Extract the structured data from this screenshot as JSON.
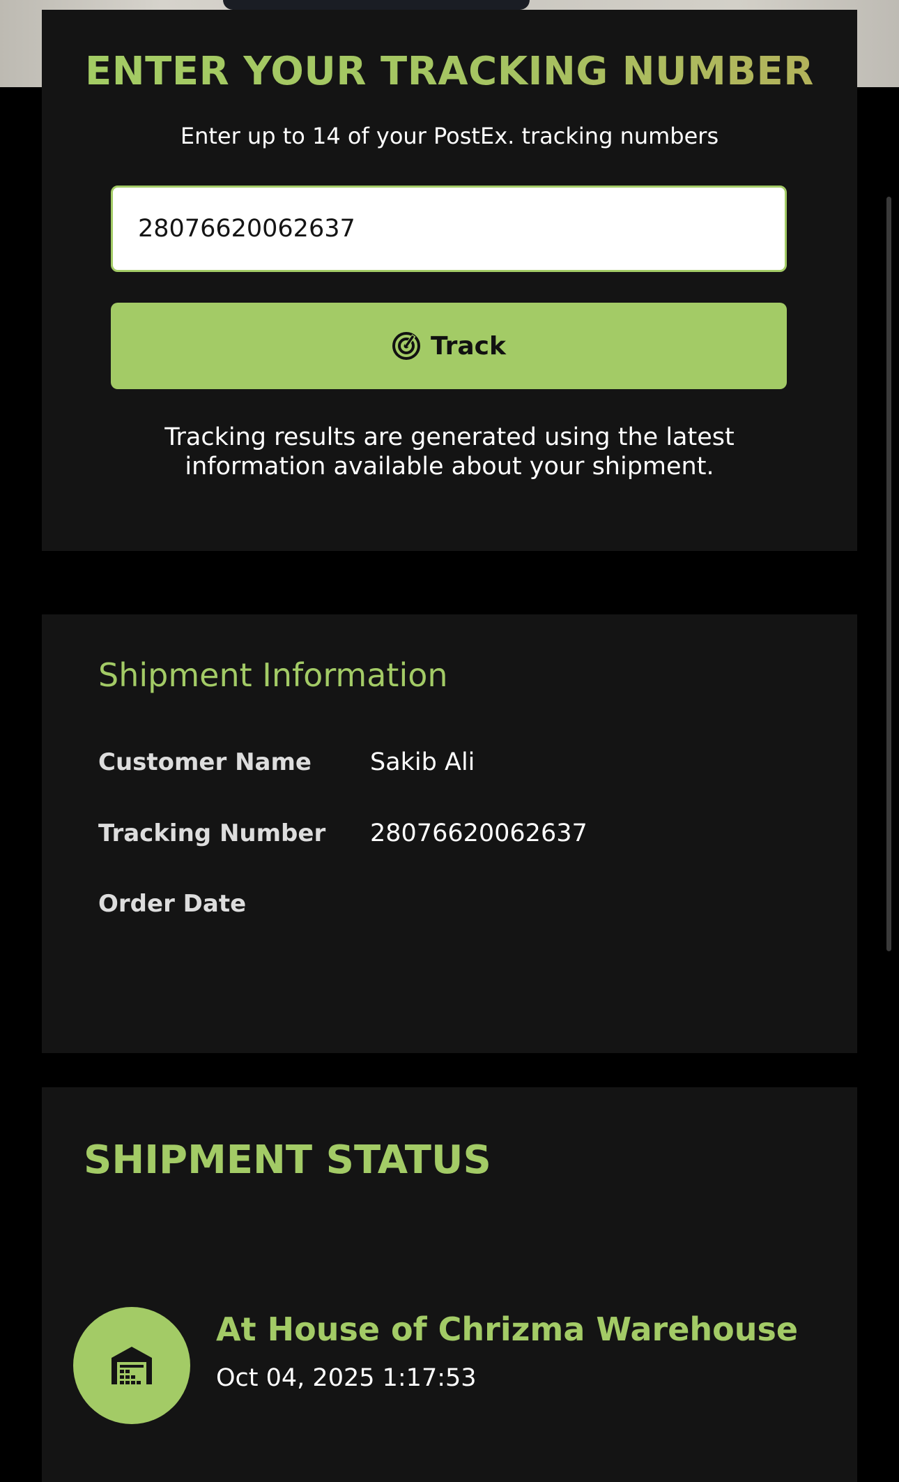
{
  "theme": {
    "accent": "#a3cb66",
    "panel_background": "#141414",
    "page_background": "#000000",
    "text": "#ffffff"
  },
  "tracking_form": {
    "title": "ENTER YOUR TRACKING NUMBER",
    "subtitle": "Enter up to 14 of your PostEx. tracking numbers",
    "input_value": "28076620062637",
    "button_label": "Track",
    "button_icon": "radar-icon",
    "note": "Tracking results are generated using the latest information available about your shipment."
  },
  "shipment_info": {
    "title": "Shipment Information",
    "rows": [
      {
        "label": "Customer Name",
        "value": "Sakib Ali"
      },
      {
        "label": "Tracking Number",
        "value": "28076620062637"
      },
      {
        "label": "Order Date",
        "value": ""
      }
    ]
  },
  "shipment_status": {
    "title": "SHIPMENT STATUS",
    "events": [
      {
        "icon": "warehouse-icon",
        "label": "At House of Chrizma Warehouse",
        "timestamp": "Oct 04, 2025 1:17:53"
      }
    ]
  }
}
